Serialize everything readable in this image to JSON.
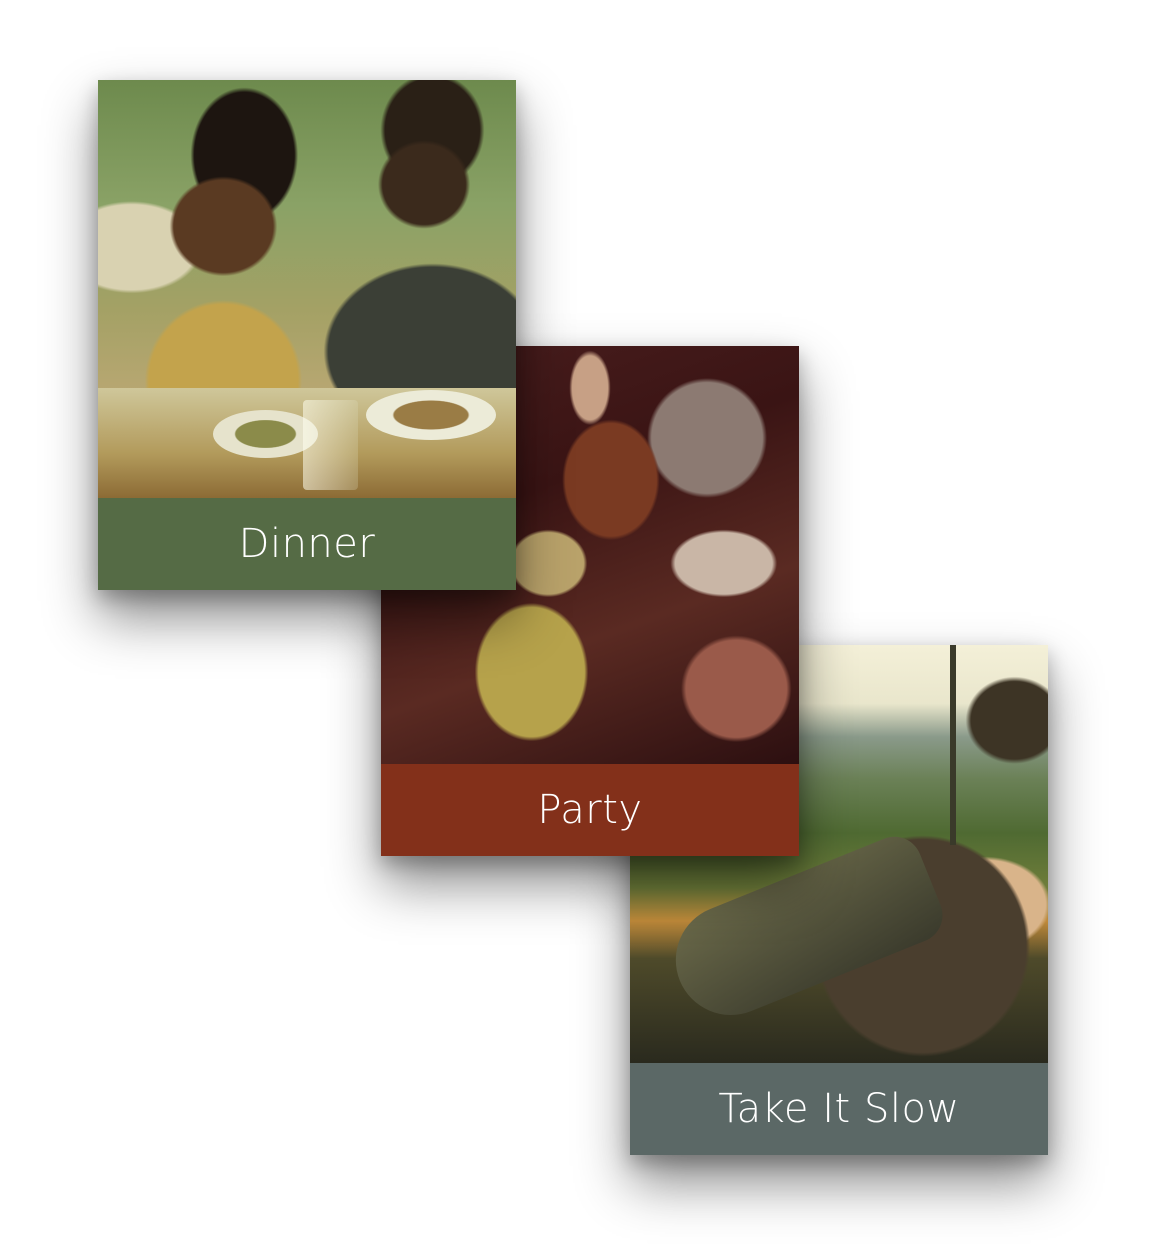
{
  "cards": [
    {
      "label": "Dinner",
      "color": "#556b45"
    },
    {
      "label": "Party",
      "color": "#83301a"
    },
    {
      "label": "Take It Slow",
      "color": "#5b6866"
    }
  ]
}
